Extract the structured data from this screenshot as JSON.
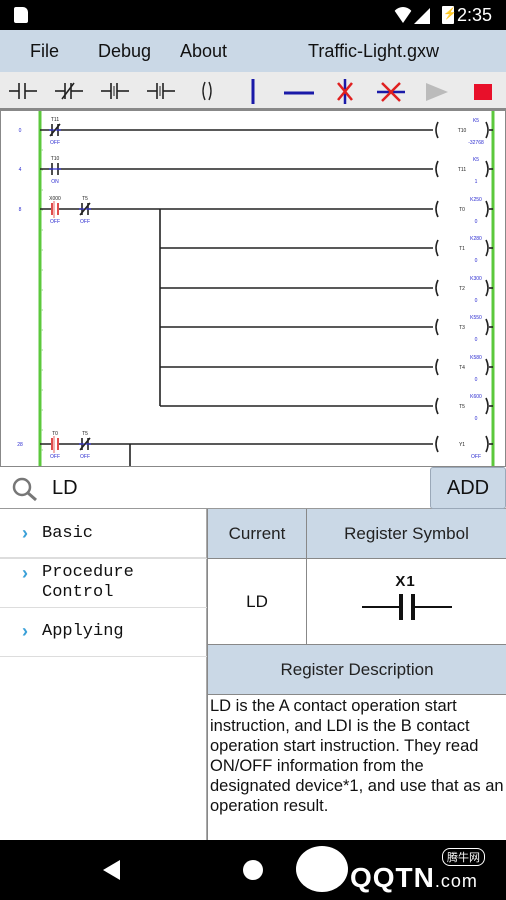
{
  "status_bar": {
    "time": "2:35",
    "icons": [
      "sd-card-icon",
      "wifi-icon",
      "signal-icon",
      "battery-charging-icon"
    ]
  },
  "menu": {
    "items": [
      "File",
      "Debug",
      "About"
    ],
    "file_title": "Traffic-Light.gxw"
  },
  "toolbar": {
    "buttons": [
      {
        "name": "contact-a-button",
        "icon": "contact-no-icon"
      },
      {
        "name": "contact-b-button",
        "icon": "contact-nc-icon"
      },
      {
        "name": "rising-edge-button",
        "icon": "contact-rising-icon"
      },
      {
        "name": "falling-edge-button",
        "icon": "contact-falling-icon"
      },
      {
        "name": "coil-button",
        "icon": "coil-icon"
      },
      {
        "name": "vertical-line-button",
        "icon": "vertical-line-icon"
      },
      {
        "name": "horizontal-line-button",
        "icon": "horizontal-line-icon"
      },
      {
        "name": "delete-vertical-line-button",
        "icon": "delete-vertical-icon"
      },
      {
        "name": "delete-horizontal-line-button",
        "icon": "delete-horizontal-icon"
      },
      {
        "name": "run-button",
        "icon": "play-icon"
      },
      {
        "name": "stop-button",
        "icon": "stop-icon"
      }
    ],
    "colors": {
      "line": "#1a1aa8",
      "delete": "#e02020",
      "run_disabled": "#bbbbbb",
      "stop": "#e8102a"
    }
  },
  "ladder": {
    "rungs": [
      {
        "step": "0",
        "contacts": [
          {
            "label": "T11",
            "type": "nc",
            "state": "OFF"
          }
        ],
        "coil": {
          "label": "T10",
          "setting": "K5",
          "value": "-32768"
        }
      },
      {
        "step": "4",
        "contacts": [
          {
            "label": "T10",
            "type": "no",
            "state": "ON"
          }
        ],
        "coil": {
          "label": "T11",
          "setting": "K5",
          "value": "1"
        }
      },
      {
        "step": "8",
        "contacts": [
          {
            "label": "X000",
            "type": "no-active",
            "state": "OFF"
          },
          {
            "label": "T5",
            "type": "nc",
            "state": "OFF"
          }
        ],
        "coil": {
          "label": "T0",
          "setting": "K250",
          "value": "0"
        }
      },
      {
        "step": "",
        "branch": true,
        "coil": {
          "label": "T1",
          "setting": "K280",
          "value": "0"
        }
      },
      {
        "step": "",
        "branch": true,
        "coil": {
          "label": "T2",
          "setting": "K300",
          "value": "0"
        }
      },
      {
        "step": "",
        "branch": true,
        "coil": {
          "label": "T3",
          "setting": "K550",
          "value": "0"
        }
      },
      {
        "step": "",
        "branch": true,
        "coil": {
          "label": "T4",
          "setting": "K580",
          "value": "0"
        }
      },
      {
        "step": "",
        "branch": true,
        "coil": {
          "label": "T5",
          "setting": "K600",
          "value": "0"
        }
      },
      {
        "step": "28",
        "contacts": [
          {
            "label": "T0",
            "type": "no-active",
            "state": "OFF"
          },
          {
            "label": "T5",
            "type": "nc",
            "state": "OFF"
          }
        ],
        "coil": {
          "label": "Y1",
          "setting": "",
          "value": "OFF"
        }
      }
    ]
  },
  "search": {
    "value": "LD",
    "placeholder": "",
    "add_label": "ADD"
  },
  "categories": [
    {
      "label": "Basic"
    },
    {
      "label": "Procedure Control"
    },
    {
      "label": "Applying"
    }
  ],
  "detail": {
    "current_header": "Current",
    "symbol_header": "Register Symbol",
    "current_value": "LD",
    "symbol_device": "X1",
    "description_header": "Register Description",
    "description": "LD is the A contact operation start instruction, and LDI is the B contact operation start instruction. They read ON/OFF information from the designated device*1, and use that as an operation result."
  },
  "watermark": {
    "text": "QQTN",
    "suffix": ".com",
    "cn": "腾牛网"
  }
}
